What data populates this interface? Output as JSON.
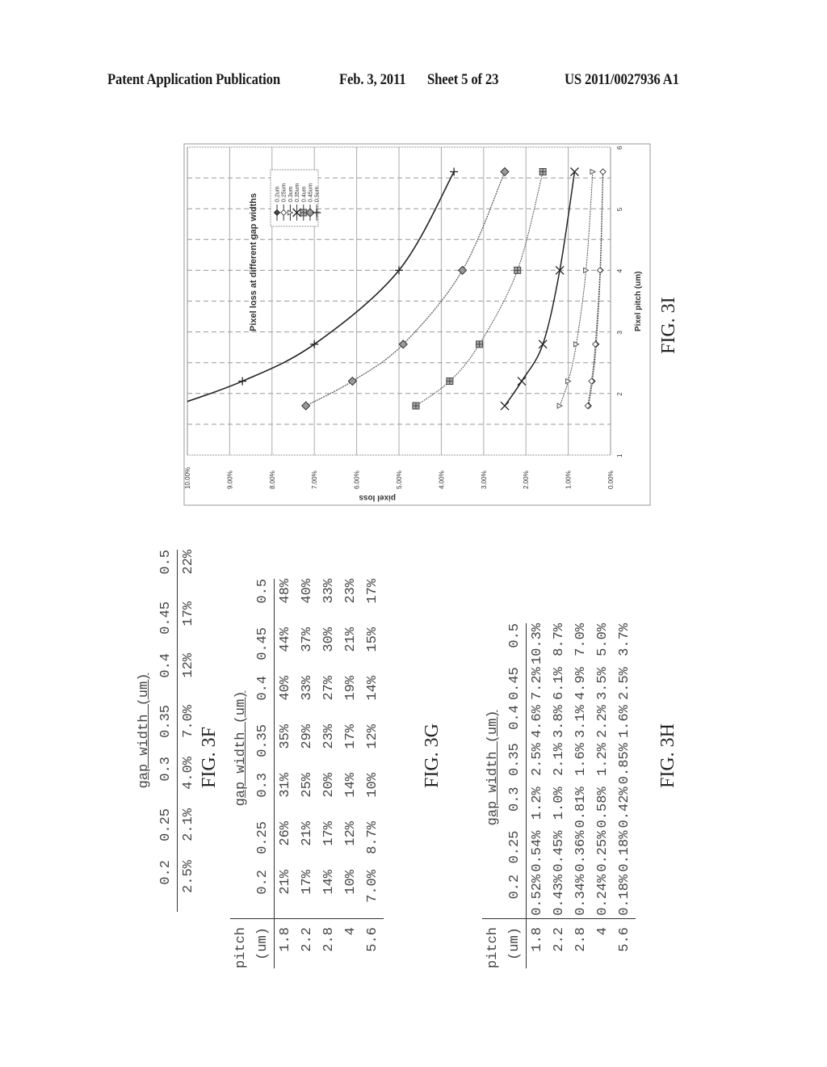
{
  "header": {
    "publication": "Patent Application Publication",
    "date": "Feb. 3, 2011",
    "sheet": "Sheet 5 of 23",
    "number": "US 2011/0027936 A1"
  },
  "fig3f": {
    "label": "FIG. 3F",
    "group_header": "gap width (um)",
    "columns": [
      "0.2",
      "0.25",
      "0.3",
      "0.35",
      "0.4",
      "0.45",
      "0.5"
    ],
    "values": [
      "2.5%",
      "2.1%",
      "4.0%",
      "7.0%",
      "12%",
      "17%",
      "22%"
    ]
  },
  "fig3g": {
    "label": "FIG. 3G",
    "row_header": [
      "pitch",
      "(um)"
    ],
    "group_header": "gap width (um)",
    "columns": [
      "0.2",
      "0.25",
      "0.3",
      "0.35",
      "0.4",
      "0.45",
      "0.5"
    ],
    "rows": [
      {
        "pitch": "1.8",
        "values": [
          "21%",
          "26%",
          "31%",
          "35%",
          "40%",
          "44%",
          "48%"
        ]
      },
      {
        "pitch": "2.2",
        "values": [
          "17%",
          "21%",
          "25%",
          "29%",
          "33%",
          "37%",
          "40%"
        ]
      },
      {
        "pitch": "2.8",
        "values": [
          "14%",
          "17%",
          "20%",
          "23%",
          "27%",
          "30%",
          "33%"
        ]
      },
      {
        "pitch": "4",
        "values": [
          "10%",
          "12%",
          "14%",
          "17%",
          "19%",
          "21%",
          "23%"
        ]
      },
      {
        "pitch": "5.6",
        "values": [
          "7.0%",
          "8.7%",
          "10%",
          "12%",
          "14%",
          "15%",
          "17%"
        ]
      }
    ]
  },
  "fig3h": {
    "label": "FIG. 3H",
    "row_header": [
      "pitch",
      "(um)"
    ],
    "group_header": "gap width (um)",
    "columns": [
      "0.2",
      "0.25",
      "0.3",
      "0.35",
      "0.4",
      "0.45",
      "0.5"
    ],
    "rows": [
      {
        "pitch": "1.8",
        "values": [
          "0.52%",
          "0.54%",
          "1.2%",
          "2.5%",
          "4.6%",
          "7.2%",
          "10.3%"
        ]
      },
      {
        "pitch": "2.2",
        "values": [
          "0.43%",
          "0.45%",
          "1.0%",
          "2.1%",
          "3.8%",
          "6.1%",
          "8.7%"
        ]
      },
      {
        "pitch": "2.8",
        "values": [
          "0.34%",
          "0.36%",
          "0.81%",
          "1.6%",
          "3.1%",
          "4.9%",
          "7.0%"
        ]
      },
      {
        "pitch": "4",
        "values": [
          "0.24%",
          "0.25%",
          "0.58%",
          "1.2%",
          "2.2%",
          "3.5%",
          "5.0%"
        ]
      },
      {
        "pitch": "5.6",
        "values": [
          "0.18%",
          "0.18%",
          "0.42%",
          "0.85%",
          "1.6%",
          "2.5%",
          "3.7%"
        ]
      }
    ]
  },
  "fig3i": {
    "label": "FIG. 3I"
  },
  "chart_data": {
    "type": "line",
    "title": "Pixel loss at different gap widths",
    "xlabel": "Pixel pitch (um)",
    "ylabel": "pixel loss",
    "xlim": [
      1,
      6
    ],
    "ylim": [
      0,
      10
    ],
    "x_ticks": [
      "1",
      "2",
      "3",
      "4",
      "5",
      "6"
    ],
    "y_ticks": [
      "0.00%",
      "1.00%",
      "2.00%",
      "3.00%",
      "4.00%",
      "5.00%",
      "6.00%",
      "7.00%",
      "8.00%",
      "9.00%",
      "10.00%"
    ],
    "grid": true,
    "legend_position": "top-left",
    "orientation": "rotated 90 degrees counter-clockwise on page",
    "x": [
      1.8,
      2.2,
      2.8,
      4,
      5.6
    ],
    "series": [
      {
        "name": "0.2um",
        "marker": "diamond",
        "values": [
          0.52,
          0.43,
          0.34,
          0.24,
          0.18
        ]
      },
      {
        "name": "0.25um",
        "marker": "diamond-open",
        "values": [
          0.54,
          0.45,
          0.36,
          0.25,
          0.18
        ]
      },
      {
        "name": "0.3um",
        "marker": "triangle",
        "values": [
          1.2,
          1.0,
          0.81,
          0.58,
          0.42
        ]
      },
      {
        "name": "0.35um",
        "marker": "x",
        "values": [
          2.5,
          2.1,
          1.6,
          1.2,
          0.85
        ]
      },
      {
        "name": "0.4um",
        "marker": "square-hatched",
        "values": [
          4.6,
          3.8,
          3.1,
          2.2,
          1.6
        ]
      },
      {
        "name": "0.45um",
        "marker": "diamond-hatched",
        "values": [
          7.2,
          6.1,
          4.9,
          3.5,
          2.5
        ]
      },
      {
        "name": "0.5um",
        "marker": "plus",
        "values": [
          10.3,
          8.7,
          7.0,
          5.0,
          3.7
        ]
      }
    ]
  }
}
